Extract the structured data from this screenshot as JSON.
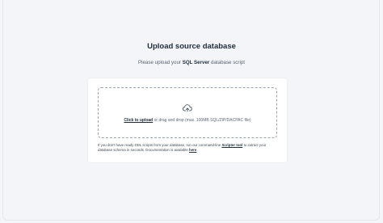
{
  "header": {
    "title": "Upload source database",
    "subtitle_prefix": "Please upload your",
    "subtitle_highlight": "SQL Server",
    "subtitle_suffix": "database script"
  },
  "dropzone": {
    "icon": "cloud-upload-icon",
    "link_label": "Click to upload",
    "hint": "or drag and drop (max. 100MB SQL/ZIP/DACPAC file)"
  },
  "footnote": {
    "text_before_link": "If you don't have ready DDL scripts from your database, run our command-line",
    "tool_link": "Scripter tool",
    "text_middle": "to extract your database schema in seconds. Documentation is available",
    "here_link": "here",
    "text_end": "."
  }
}
